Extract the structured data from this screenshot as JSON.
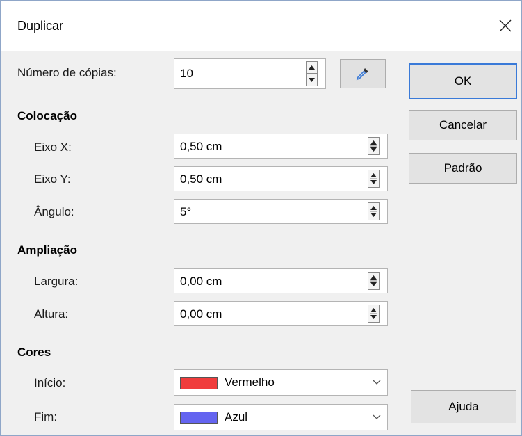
{
  "dialog": {
    "title": "Duplicar"
  },
  "copies": {
    "label": "Número de cópias:",
    "value": "10"
  },
  "placement": {
    "heading": "Colocação",
    "x": {
      "label": "Eixo X:",
      "value": "0,50 cm"
    },
    "y": {
      "label": "Eixo Y:",
      "value": "0,50 cm"
    },
    "angle": {
      "label": "Ângulo:",
      "value": "5°"
    }
  },
  "enlargement": {
    "heading": "Ampliação",
    "width": {
      "label": "Largura:",
      "value": "0,00 cm"
    },
    "height": {
      "label": "Altura:",
      "value": "0,00 cm"
    }
  },
  "colors": {
    "heading": "Cores",
    "start": {
      "label": "Início:",
      "value": "Vermelho",
      "swatch": "#f03c3c"
    },
    "end": {
      "label": "Fim:",
      "value": "Azul",
      "swatch": "#6464f0"
    }
  },
  "buttons": {
    "ok": "OK",
    "cancel": "Cancelar",
    "default": "Padrão",
    "help": "Ajuda"
  },
  "icons": {
    "close": "close-icon",
    "eyedropper": "eyedropper-icon",
    "spin": "spin-arrows-icon",
    "dropdown": "chevron-down-icon"
  },
  "accent_color": "#3a7ad8"
}
